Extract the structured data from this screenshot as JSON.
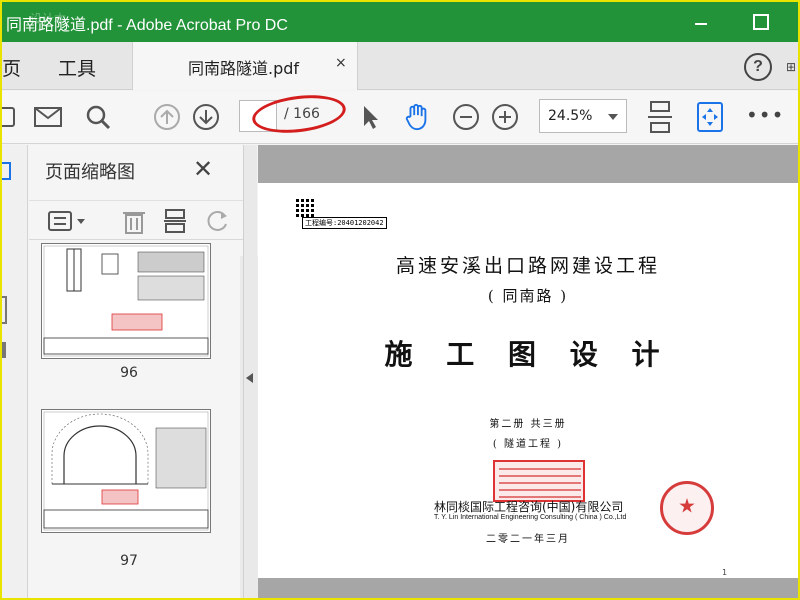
{
  "window": {
    "title": "同南路隧道.pdf - Adobe Acrobat Pro DC",
    "watermark": "设计本"
  },
  "nav": {
    "home": "页",
    "tools": "工具"
  },
  "tab": {
    "label": "同南路隧道.pdf",
    "close": "×"
  },
  "help": "?",
  "toolbar": {
    "current_page": "",
    "total_pages": "/ 166",
    "zoom": "24.5%",
    "more": "•••"
  },
  "thumbnails": {
    "title": "页面缩略图",
    "pages": [
      {
        "label": "96"
      },
      {
        "label": "97"
      }
    ]
  },
  "document": {
    "code": "工程编号:20401202042",
    "title": "高速安溪出口路网建设工程",
    "subtitle": "( 同南路 )",
    "heading": "施 工 图 设 计",
    "volume": "第二册   共三册",
    "section": "( 隧道工程 )",
    "company_cn": "林同棪国际工程咨询(中国)有限公司",
    "company_en": "T. Y. Lin International Engineering Consulting ( China ) Co.,Ltd",
    "date": "二零二一年三月",
    "page_number": "1"
  },
  "colors": {
    "titlebar": "#23933a",
    "accent_blue": "#1a73e8",
    "annotation_red": "#d41e1e"
  }
}
